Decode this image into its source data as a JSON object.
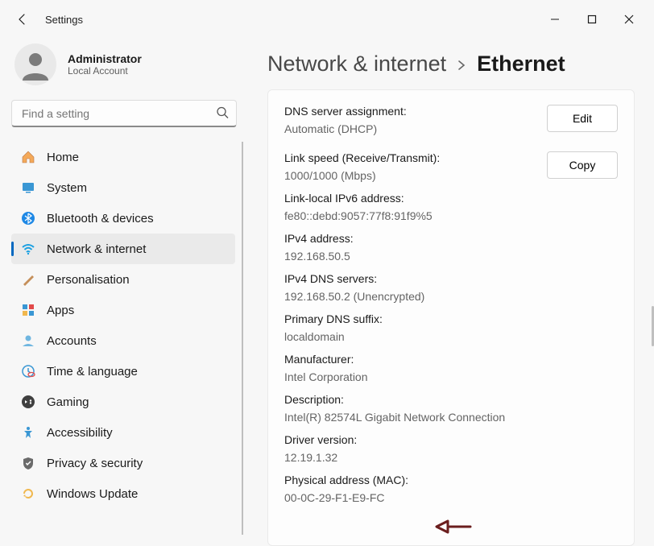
{
  "window": {
    "title": "Settings"
  },
  "user": {
    "name": "Administrator",
    "subtitle": "Local Account"
  },
  "search": {
    "placeholder": "Find a setting"
  },
  "sidebar": {
    "items": [
      {
        "label": "Home",
        "icon": "home-icon"
      },
      {
        "label": "System",
        "icon": "system-icon"
      },
      {
        "label": "Bluetooth & devices",
        "icon": "bluetooth-icon"
      },
      {
        "label": "Network & internet",
        "icon": "wifi-icon"
      },
      {
        "label": "Personalisation",
        "icon": "brush-icon"
      },
      {
        "label": "Apps",
        "icon": "apps-icon"
      },
      {
        "label": "Accounts",
        "icon": "accounts-icon"
      },
      {
        "label": "Time & language",
        "icon": "time-icon"
      },
      {
        "label": "Gaming",
        "icon": "gaming-icon"
      },
      {
        "label": "Accessibility",
        "icon": "accessibility-icon"
      },
      {
        "label": "Privacy & security",
        "icon": "privacy-icon"
      },
      {
        "label": "Windows Update",
        "icon": "update-icon"
      }
    ],
    "active_index": 3
  },
  "breadcrumb": {
    "parent": "Network & internet",
    "current": "Ethernet"
  },
  "buttons": {
    "edit": "Edit",
    "copy": "Copy"
  },
  "details": {
    "dns_assignment_label": "DNS server assignment:",
    "dns_assignment_value": "Automatic (DHCP)",
    "link_speed_label": "Link speed (Receive/Transmit):",
    "link_speed_value": "1000/1000 (Mbps)",
    "ipv6_ll_label": "Link-local IPv6 address:",
    "ipv6_ll_value": "fe80::debd:9057:77f8:91f9%5",
    "ipv4_label": "IPv4 address:",
    "ipv4_value": "192.168.50.5",
    "ipv4_dns_label": "IPv4 DNS servers:",
    "ipv4_dns_value": "192.168.50.2 (Unencrypted)",
    "dns_suffix_label": "Primary DNS suffix:",
    "dns_suffix_value": "localdomain",
    "manufacturer_label": "Manufacturer:",
    "manufacturer_value": "Intel Corporation",
    "description_label": "Description:",
    "description_value": "Intel(R) 82574L Gigabit Network Connection",
    "driver_label": "Driver version:",
    "driver_value": "12.19.1.32",
    "mac_label": "Physical address (MAC):",
    "mac_value": "00-0C-29-F1-E9-FC"
  }
}
